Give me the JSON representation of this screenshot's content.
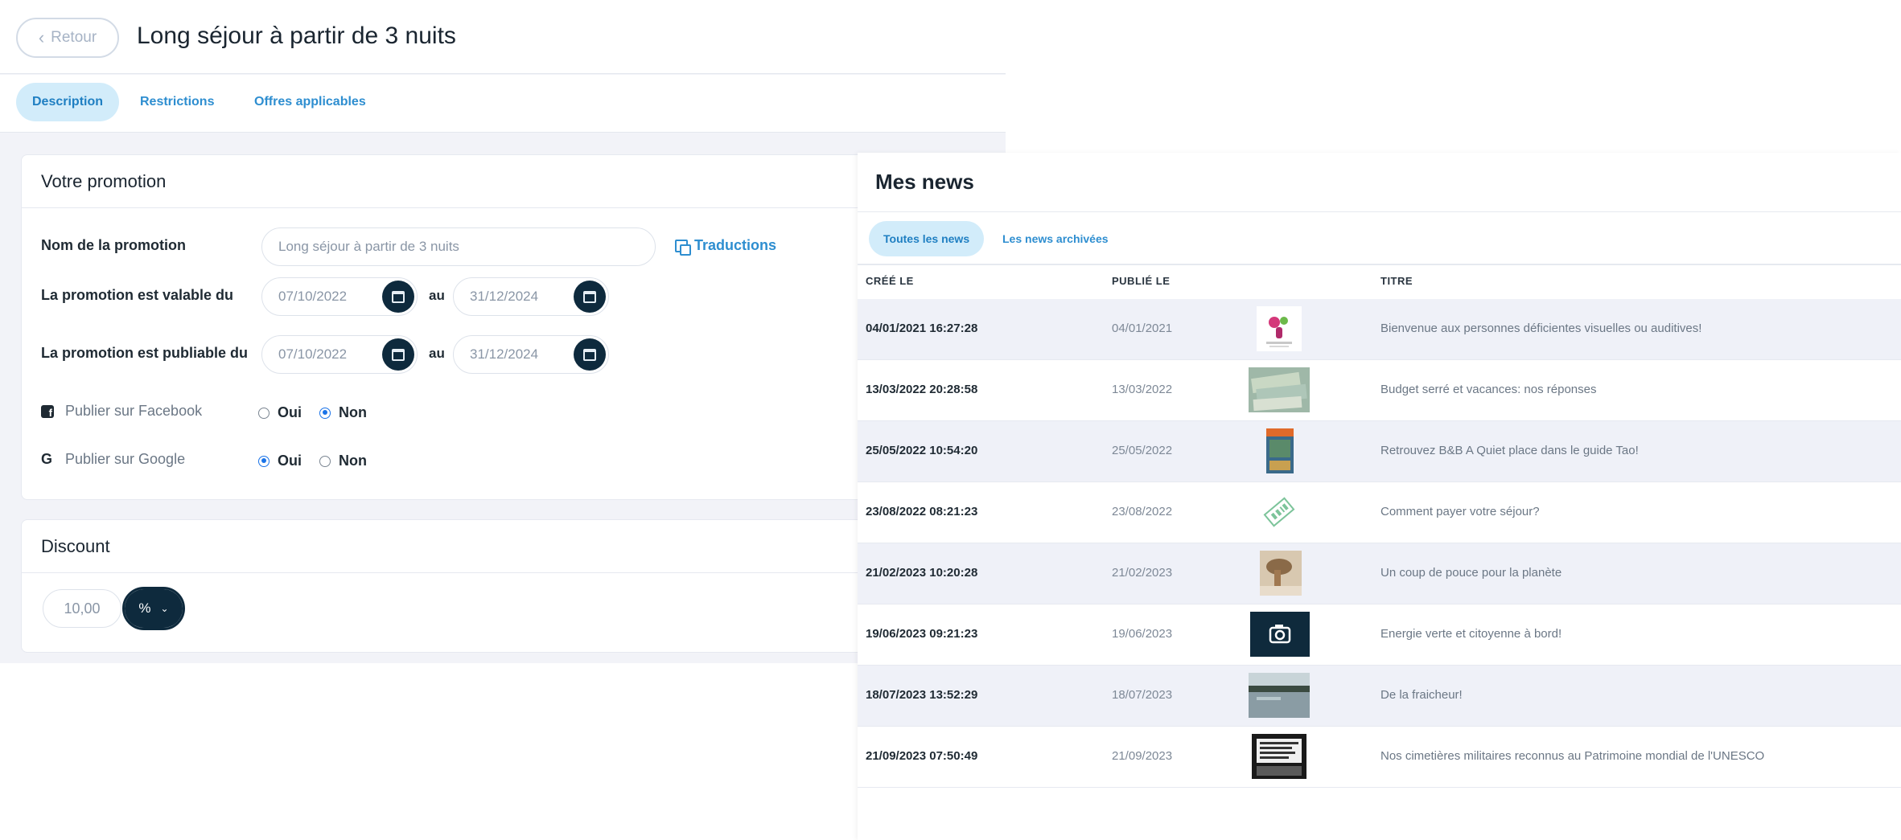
{
  "promo": {
    "back_label": "Retour",
    "title": "Long séjour à partir de 3 nuits",
    "tabs": [
      {
        "label": "Description",
        "active": true
      },
      {
        "label": "Restrictions",
        "active": false
      },
      {
        "label": "Offres applicables",
        "active": false
      }
    ],
    "section_title": "Votre promotion",
    "name_label": "Nom de la promotion",
    "name_value": "Long séjour à partir de 3 nuits",
    "translations_label": "Traductions",
    "valid_label": "La promotion est valable du",
    "valid_from": "07/10/2022",
    "valid_to": "31/12/2024",
    "publish_label": "La promotion est publiable du",
    "publish_from": "07/10/2022",
    "publish_to": "31/12/2024",
    "au_label": "au",
    "facebook_label": "Publier sur Facebook",
    "google_label": "Publier sur Google",
    "yes_label": "Oui",
    "no_label": "Non",
    "facebook_value": "Non",
    "google_value": "Oui",
    "discount_title": "Discount",
    "discount_value": "10,00",
    "discount_unit": "%"
  },
  "news": {
    "title": "Mes news",
    "tabs": [
      {
        "label": "Toutes les news",
        "active": true
      },
      {
        "label": "Les news archivées",
        "active": false
      }
    ],
    "columns": {
      "created": "CRÉÉ LE",
      "published": "PUBLIÉ LE",
      "title": "TITRE"
    },
    "rows": [
      {
        "created": "04/01/2021 16:27:28",
        "published": "04/01/2021",
        "thumb": "logo-thumbnail",
        "title": "Bienvenue aux personnes déficientes visuelles ou auditives!"
      },
      {
        "created": "13/03/2022 20:28:58",
        "published": "13/03/2022",
        "thumb": "banknotes-thumbnail",
        "title": "Budget serré et vacances: nos réponses"
      },
      {
        "created": "25/05/2022 10:54:20",
        "published": "25/05/2022",
        "thumb": "guide-book-thumbnail",
        "title": "Retrouvez B&B A Quiet place dans le guide Tao!"
      },
      {
        "created": "23/08/2022 08:21:23",
        "published": "23/08/2022",
        "thumb": "paid-stamp-thumbnail",
        "title": "Comment payer votre séjour?"
      },
      {
        "created": "21/02/2023 10:20:28",
        "published": "21/02/2023",
        "thumb": "hand-photo-thumbnail",
        "title": "Un coup de pouce pour la planète"
      },
      {
        "created": "19/06/2023 09:21:23",
        "published": "19/06/2023",
        "thumb": "camera-placeholder-icon",
        "title": "Energie verte et citoyenne à bord!"
      },
      {
        "created": "18/07/2023 13:52:29",
        "published": "18/07/2023",
        "thumb": "water-photo-thumbnail",
        "title": "De la fraicheur!"
      },
      {
        "created": "21/09/2023 07:50:49",
        "published": "21/09/2023",
        "thumb": "cemetery-sign-thumbnail",
        "title": "Nos cimetières militaires reconnus au Patrimoine mondial de l'UNESCO"
      }
    ]
  },
  "colors": {
    "accent": "#2e8ed0",
    "active_tab_bg": "#d2ecfa",
    "dark_button": "#0e2a3d",
    "row_shade": "#eff1f8"
  }
}
